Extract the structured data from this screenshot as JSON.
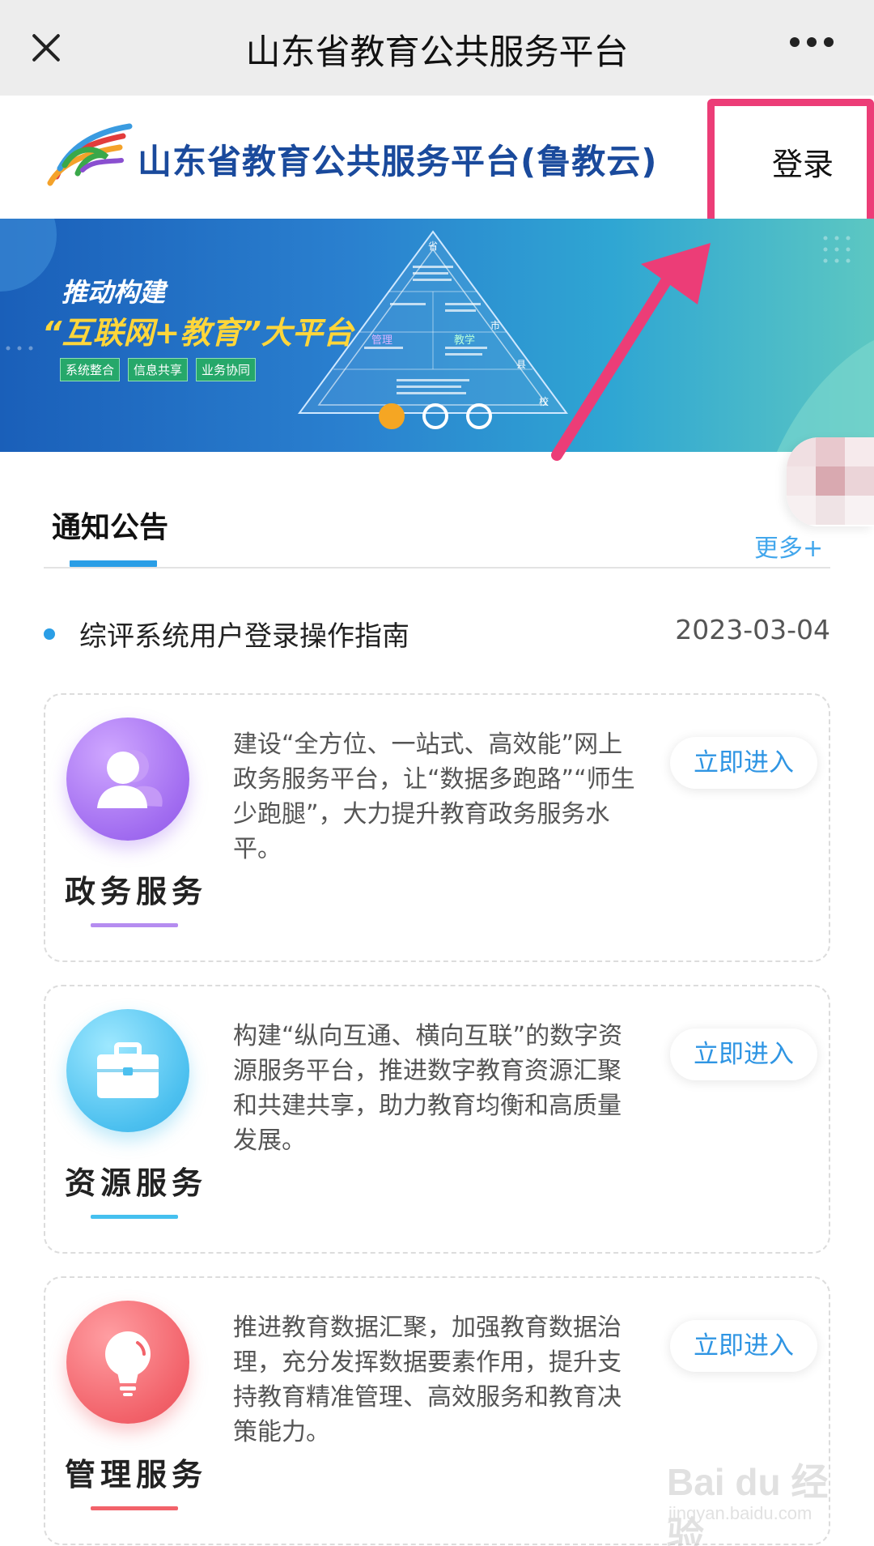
{
  "window": {
    "title": "山东省教育公共服务平台"
  },
  "header": {
    "site_name": "山东省教育公共服务平台(鲁教云)",
    "login_label": "登录"
  },
  "banner": {
    "slogan_line1": "推动构建",
    "slogan_line2": "“互联网+教育”大平台",
    "tags": [
      "系统整合",
      "信息共享",
      "业务协同"
    ],
    "pyramid_labels": [
      "省",
      "市",
      "县",
      "校",
      "管理",
      "教学"
    ],
    "slides_total": 3,
    "active_slide": 1
  },
  "notice": {
    "section_title": "通知公告",
    "more_label": "更多+",
    "items": [
      {
        "title": "综评系统用户登录操作指南",
        "date": "2023-03-04"
      }
    ]
  },
  "services": [
    {
      "title": "政务服务",
      "description": "建设“全方位、一站式、高效能”网上政务服务平台，让“数据多跑路”“师生少跑腿”，大力提升教育政务服务水平。",
      "button": "立即进入",
      "icon": "user-group-icon",
      "accent": "#a87ef2"
    },
    {
      "title": "资源服务",
      "description": "构建“纵向互通、横向互联”的数字资源服务平台，推进数字教育资源汇聚和共建共享，助力教育均衡和高质量发展。",
      "button": "立即进入",
      "icon": "briefcase-icon",
      "accent": "#45c0ef"
    },
    {
      "title": "管理服务",
      "description": "推进教育数据汇聚，加强教育数据治理，充分发挥数据要素作用，提升支持教育精准管理、高效服务和教育决策能力。",
      "button": "立即进入",
      "icon": "lightbulb-icon",
      "accent": "#f2626a"
    }
  ],
  "watermark": {
    "main": "Bai du 经验",
    "sub": "jingyan.baidu.com"
  },
  "colors": {
    "highlight_box": "#ec3d77",
    "link_blue": "#2f95e3",
    "banner_blue": "#2a80cf"
  }
}
